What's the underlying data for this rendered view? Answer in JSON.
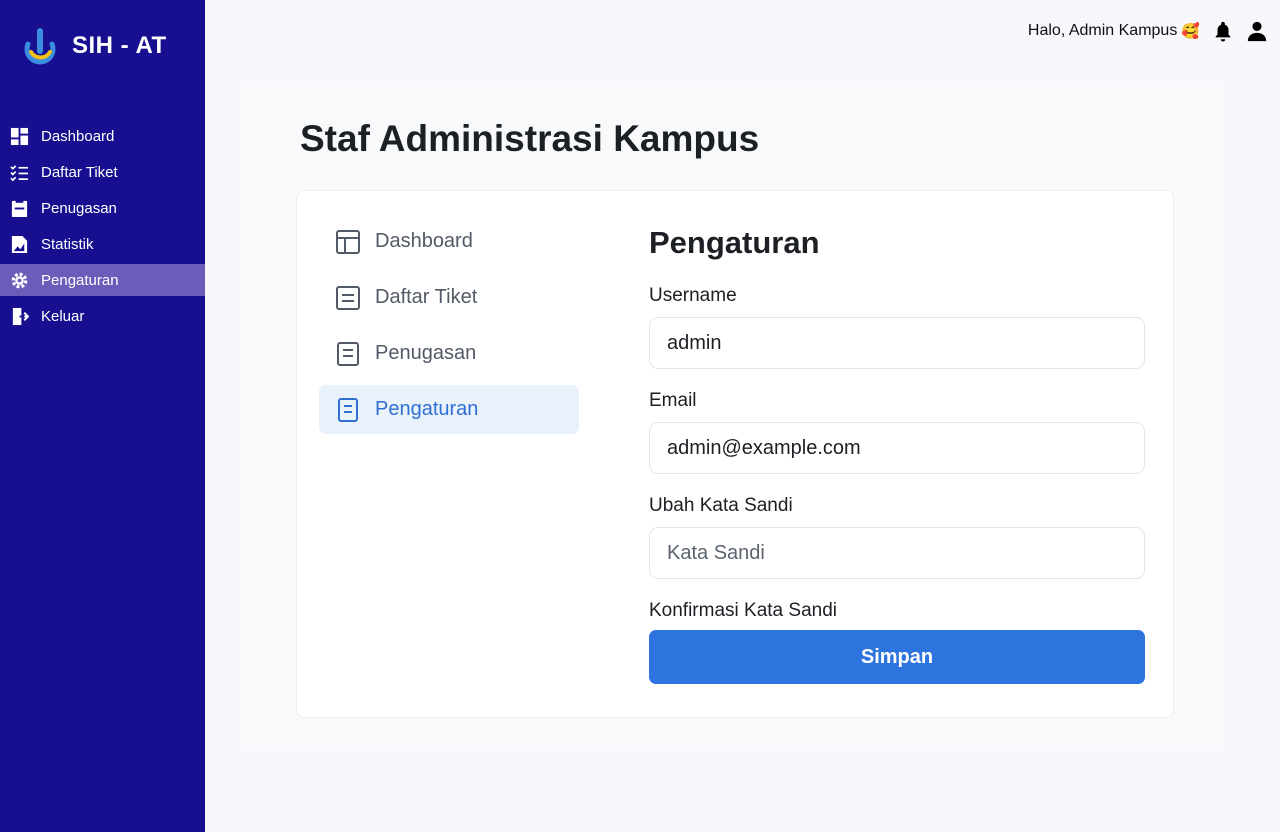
{
  "brand": {
    "name": "SIH - AT"
  },
  "sidebar": {
    "items": [
      {
        "label": "Dashboard",
        "icon": "dashboard-icon"
      },
      {
        "label": "Daftar Tiket",
        "icon": "checklist-icon"
      },
      {
        "label": "Penugasan",
        "icon": "clipboard-icon"
      },
      {
        "label": "Statistik",
        "icon": "chart-file-icon"
      },
      {
        "label": "Pengaturan",
        "icon": "gear-icon",
        "active": true
      },
      {
        "label": "Keluar",
        "icon": "logout-icon"
      }
    ]
  },
  "topbar": {
    "greeting": "Halo, Admin Kampus",
    "emoji": "🥰"
  },
  "main": {
    "title": "Staf Administrasi Kampus",
    "menu": [
      {
        "label": "Dashboard",
        "icon": "layout-icon"
      },
      {
        "label": "Daftar Tiket",
        "icon": "list-icon"
      },
      {
        "label": "Penugasan",
        "icon": "document-icon"
      },
      {
        "label": "Pengaturan",
        "icon": "settings-doc-icon",
        "active": true
      }
    ],
    "form": {
      "title": "Pengaturan",
      "username_label": "Username",
      "username_value": "admin",
      "email_label": "Email",
      "email_value": "admin@example.com",
      "password_label": "Ubah Kata Sandi",
      "password_placeholder": "Kata Sandi",
      "confirm_label": "Konfirmasi Kata Sandi",
      "save_label": "Simpan"
    }
  },
  "colors": {
    "sidebar": "#170f8f",
    "sidebar_active": "#6a5cb8",
    "accent": "#2d74de",
    "menu_active_bg": "#e9f1fb"
  }
}
